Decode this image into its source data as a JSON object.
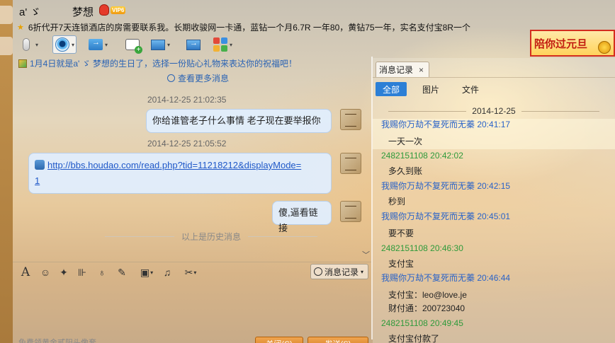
{
  "header": {
    "nickname": "a' ゞ",
    "buddy_name": "梦想",
    "vip_badge": "VIP6",
    "signature": "6折代开7天连锁酒店的房需要联系我。长期收骏网一卡通，蓝钻一个月6.7R  一年80，黄钻75一年，实名支付宝8R一个"
  },
  "banner": {
    "text": "陪你过元旦"
  },
  "toolbar": {
    "icons": [
      "microphone-icon",
      "webcam-icon",
      "send-file-icon",
      "create-discussion-icon",
      "remote-desktop-icon",
      "share-screen-icon",
      "app-grid-icon"
    ]
  },
  "chat": {
    "notice": "1月4日就是a' ゞ    梦想的生日了，选择一份贴心礼物来表达你的祝福吧！",
    "view_more": "查看更多消息",
    "messages": [
      {
        "time": "2014-12-25 21:02:35",
        "text": "你给谁管老子什么事情  老子现在要举报你"
      },
      {
        "time": "2014-12-25 21:05:52",
        "link_line1": "http://bbs.houdao.com/read.php?tid=11218212&displayMode=",
        "link_line2": "1"
      },
      {
        "text": "傻,逼看链接"
      }
    ],
    "history_divider": "以上是历史消息"
  },
  "input": {
    "history_button": "消息记录",
    "tip": "免费领黄金贰阳头像套",
    "close_label": "关闭(C)",
    "send_label": "发送(S)"
  },
  "panel": {
    "tab_label": "消息记录",
    "close_glyph": "×",
    "filters": [
      "全部",
      "图片",
      "文件"
    ],
    "date": "2014-12-25",
    "records": [
      {
        "who": "我赐你万劫不复死而无蓁 20:41:17",
        "side": "me",
        "lines": [
          "一天一次"
        ]
      },
      {
        "who": "2482151108 20:42:02",
        "side": "other",
        "lines": [
          "多久到账"
        ]
      },
      {
        "who": "我赐你万劫不复死而无蓁 20:42:15",
        "side": "me",
        "lines": [
          "秒到"
        ]
      },
      {
        "who": "我赐你万劫不复死而无蓁 20:45:01",
        "side": "me",
        "lines": [
          "要不要"
        ]
      },
      {
        "who": "2482151108 20:46:30",
        "side": "other",
        "lines": [
          "支付宝"
        ]
      },
      {
        "who": "我赐你万劫不复死而无蓁 20:46:44",
        "side": "me",
        "lines": [
          "支付宝：leo@love.je",
          "财付通：200723040"
        ]
      },
      {
        "who": "2482151108 20:49:45",
        "side": "other",
        "lines": [
          "支付宝付款了"
        ]
      }
    ]
  },
  "colors": {
    "accent": "#2c7fd6",
    "me": "#2a63c8",
    "other": "#2f9a3b",
    "button": "#d27a1f"
  }
}
